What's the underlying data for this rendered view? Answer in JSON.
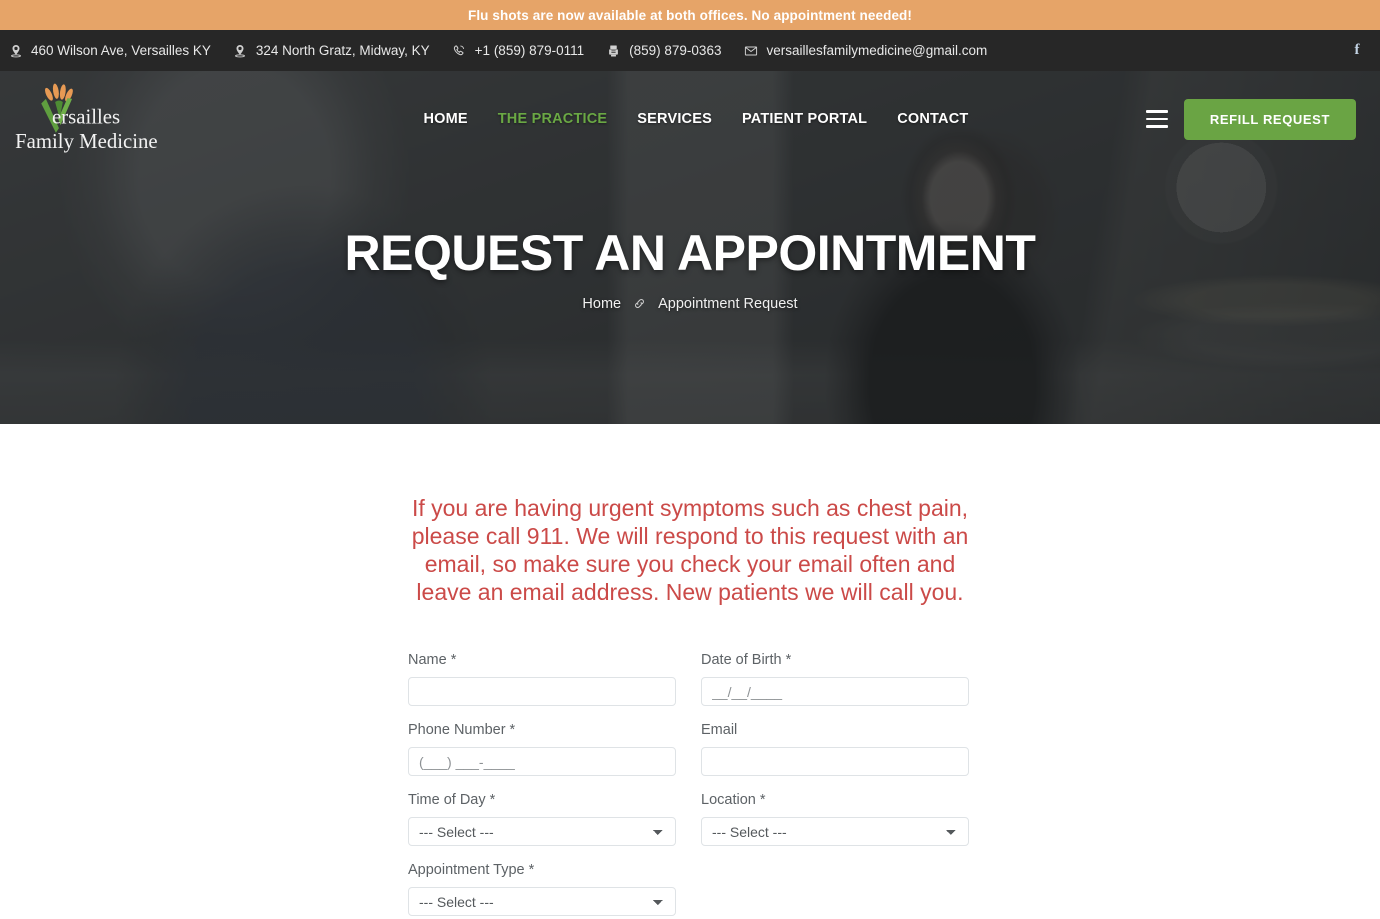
{
  "promo": {
    "text": "Flu shots are now available at both offices. No appointment needed!",
    "bg_color": "#e6a468"
  },
  "topbar": {
    "bg_color": "#272727",
    "contacts": [
      {
        "icon": "map-marker-icon",
        "label": "460 Wilson Ave, Versailles KY"
      },
      {
        "icon": "map-marker-icon",
        "label": "324 North Gratz, Midway, KY"
      },
      {
        "icon": "phone-icon",
        "label": "+1 (859) 879-0111"
      },
      {
        "icon": "fax-icon",
        "label": "(859) 879-0363"
      },
      {
        "icon": "envelope-icon",
        "label": "versaillesfamilymedicine@gmail.com"
      }
    ],
    "social": [
      {
        "icon": "facebook-icon",
        "label": "f"
      }
    ]
  },
  "header": {
    "logo": {
      "line1": "Versailles",
      "line2": "Family Medicine",
      "leaf_color": "#5f9e3f",
      "petal_color": "#e79a54"
    },
    "nav": [
      {
        "label": "HOME",
        "active": false
      },
      {
        "label": "THE PRACTICE",
        "active": true
      },
      {
        "label": "SERVICES",
        "active": false
      },
      {
        "label": "PATIENT PORTAL",
        "active": false
      },
      {
        "label": "CONTACT",
        "active": false
      }
    ],
    "menu_icon": "hamburger-icon",
    "refill_button": {
      "label": "REFILL REQUEST",
      "color": "#6aa444"
    },
    "active_color": "#6aa844"
  },
  "hero": {
    "title": "REQUEST AN APPOINTMENT",
    "breadcrumb": {
      "home": "Home",
      "separator_icon": "link-chain-icon",
      "current": "Appointment Request"
    }
  },
  "main": {
    "alert": {
      "text": "If you are having urgent symptoms such as chest pain, please call 911. We will respond to this request with an email, so make sure you check your email often and leave an email address. New patients we will call you.",
      "color": "#cb4a48"
    },
    "form": {
      "fields": {
        "name": {
          "label": "Name *",
          "value": "",
          "placeholder": ""
        },
        "dob": {
          "label": "Date of Birth *",
          "value": "",
          "placeholder": "__/__/____"
        },
        "phone": {
          "label": "Phone Number *",
          "value": "",
          "placeholder": "(___) ___-____"
        },
        "email": {
          "label": "Email",
          "value": "",
          "placeholder": ""
        },
        "time_of_day": {
          "label": "Time of Day *",
          "selected": "--- Select ---"
        },
        "location": {
          "label": "Location *",
          "selected": "--- Select ---"
        },
        "appointment_type": {
          "label": "Appointment Type *",
          "selected": "--- Select ---"
        }
      }
    }
  }
}
